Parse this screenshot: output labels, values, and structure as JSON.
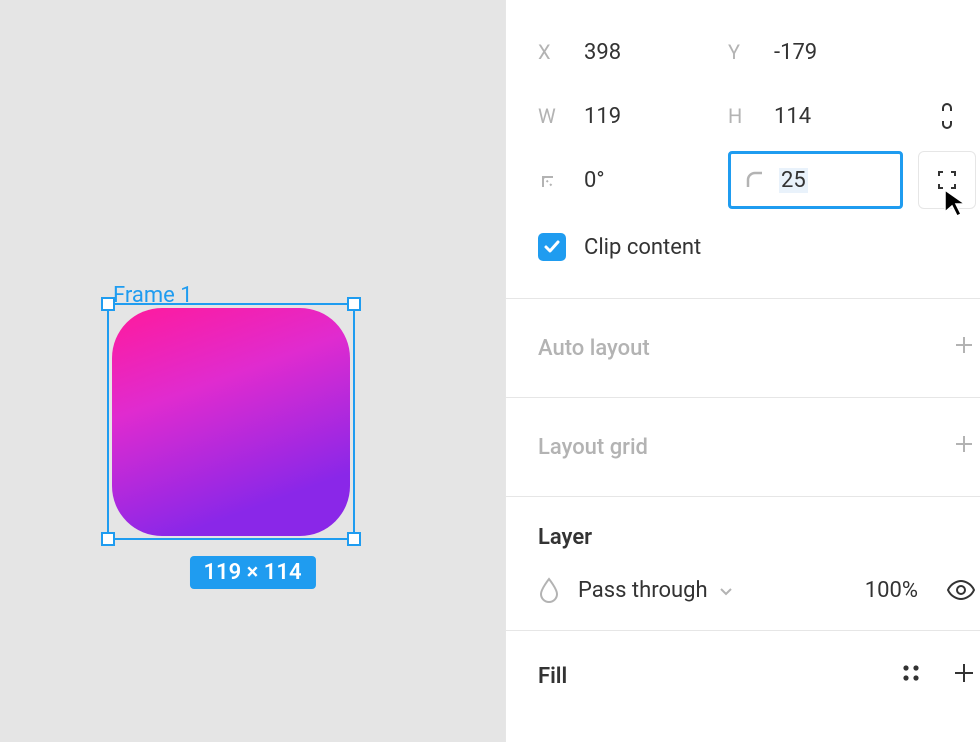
{
  "canvas": {
    "frame_label": "Frame 1",
    "size_badge": "119 × 114",
    "shape_corner_radius": 25
  },
  "transform": {
    "x_label": "X",
    "x_value": "398",
    "y_label": "Y",
    "y_value": "-179",
    "w_label": "W",
    "w_value": "119",
    "h_label": "H",
    "h_value": "114",
    "rotation_value": "0°",
    "corner_radius_value": "25"
  },
  "clip_content": {
    "label": "Clip content",
    "checked": true
  },
  "sections": {
    "auto_layout": "Auto layout",
    "layout_grid": "Layout grid",
    "layer_title": "Layer",
    "fill_title": "Fill"
  },
  "layer": {
    "blend_mode": "Pass through",
    "opacity": "100%"
  }
}
